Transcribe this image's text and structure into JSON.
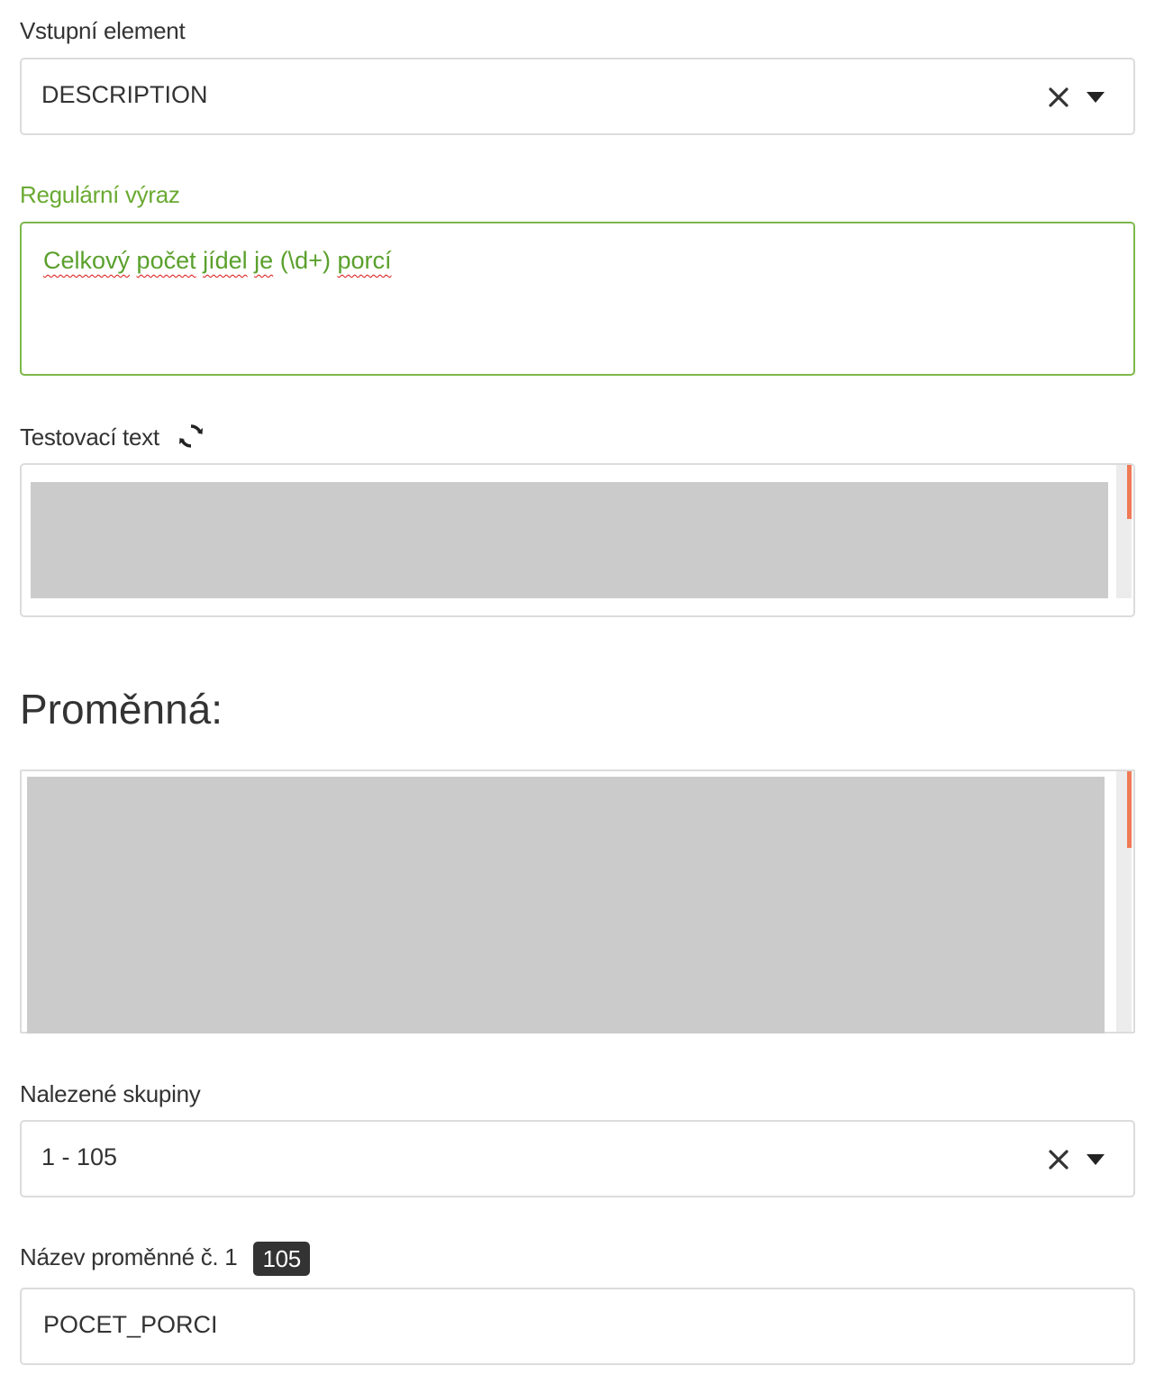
{
  "input_element": {
    "label": "Vstupní element",
    "value": "DESCRIPTION"
  },
  "regex": {
    "label": "Regulární výraz",
    "value_parts": [
      "Celkový",
      " ",
      "počet",
      " ",
      "jídel",
      " ",
      "je",
      " (\\d+) ",
      "porcí"
    ]
  },
  "test_text": {
    "label": "Testovací text"
  },
  "variable_section": {
    "heading": "Proměnná:"
  },
  "found_groups": {
    "label": "Nalezené skupiny",
    "value": "1 - 105"
  },
  "variable_name": {
    "label": "Název proměnné č. 1",
    "badge": "105",
    "value": "POCET_PORCI"
  },
  "colors": {
    "accent_green": "#6aaa32",
    "scroll_thumb": "#f07a55",
    "redacted_gray": "#cbcbcb"
  },
  "icons": {
    "clear": "close-icon",
    "dropdown": "caret-down-icon",
    "refresh": "refresh-icon"
  }
}
